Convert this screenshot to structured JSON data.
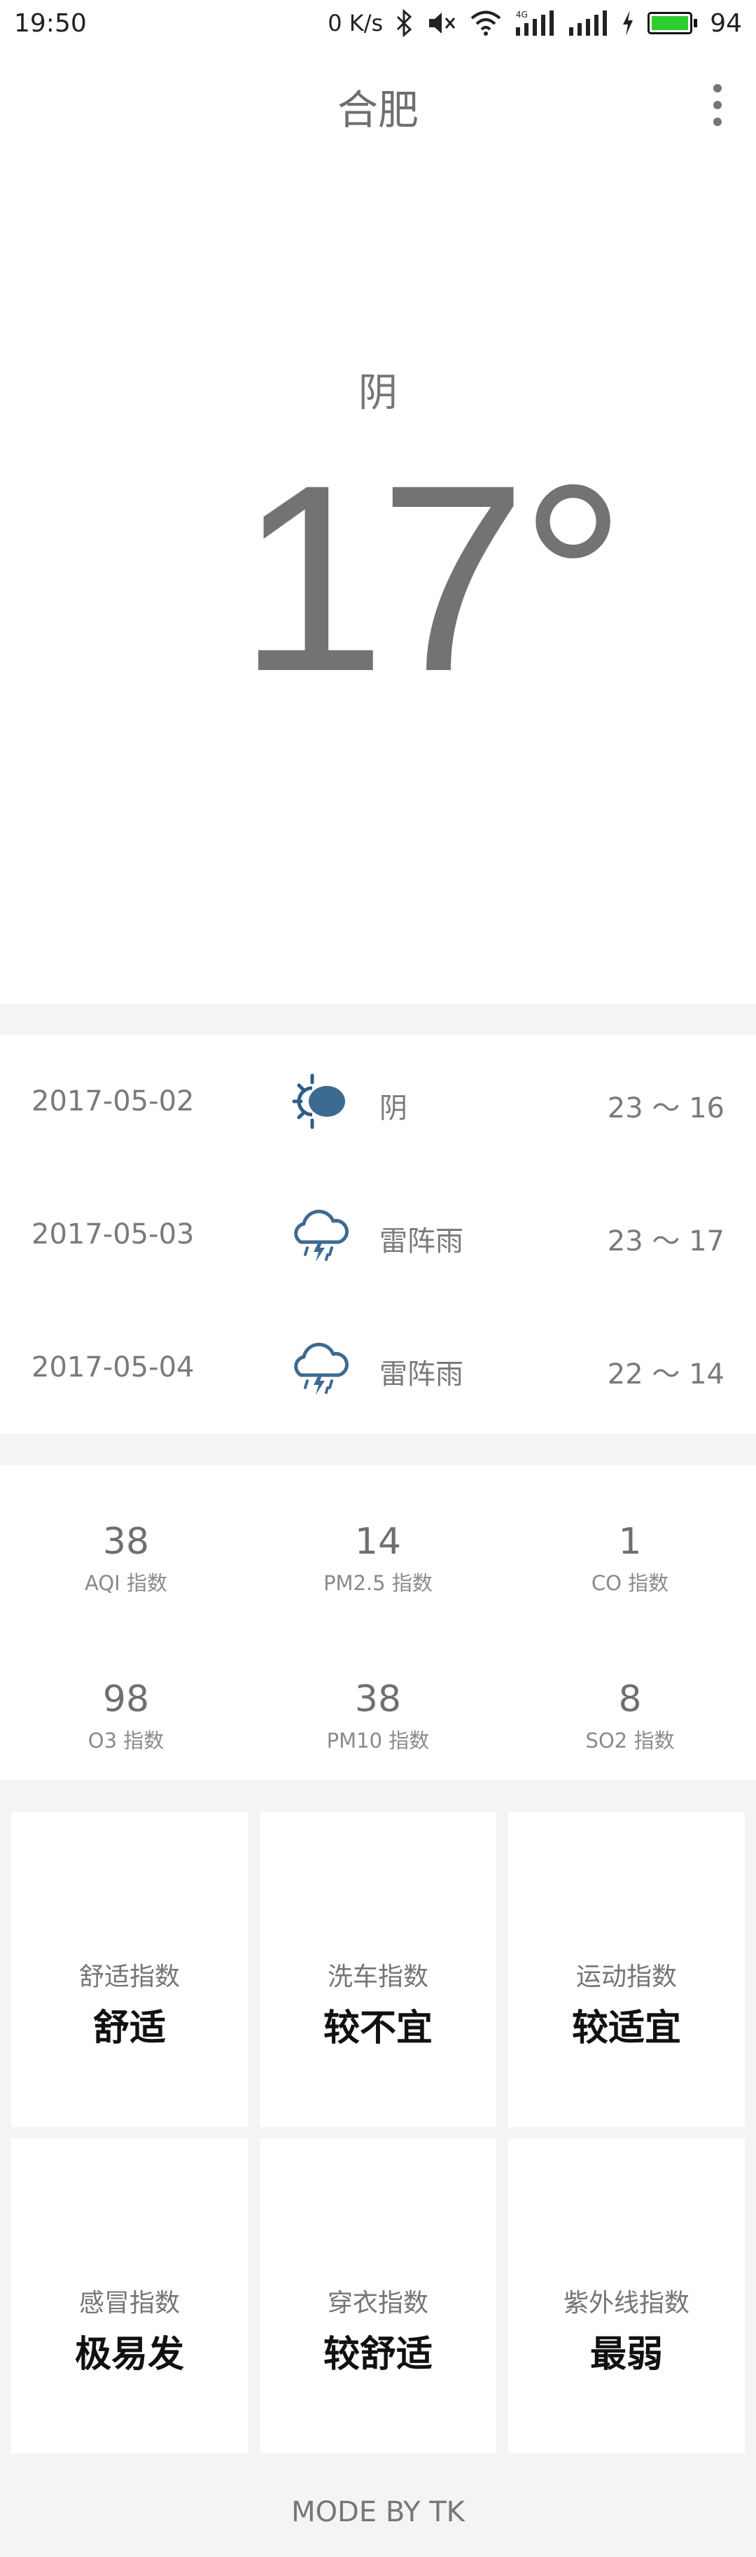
{
  "status_bar": {
    "time": "19:50",
    "net_speed": "0 K/s",
    "battery": "94",
    "icons": [
      "bluetooth-icon",
      "mute-icon",
      "wifi-icon",
      "signal-4g-icon",
      "signal-icon",
      "charging-icon",
      "battery-icon"
    ]
  },
  "header": {
    "city": "合肥",
    "menu_icon": "more-vertical-icon"
  },
  "current": {
    "condition": "阴",
    "temperature": "17°"
  },
  "forecast": [
    {
      "date": "2017-05-02",
      "icon": "cloudy-sun-icon",
      "condition": "阴",
      "range": "23 ～ 16"
    },
    {
      "date": "2017-05-03",
      "icon": "thunderstorm-icon",
      "condition": "雷阵雨",
      "range": "23 ～ 17"
    },
    {
      "date": "2017-05-04",
      "icon": "thunderstorm-icon",
      "condition": "雷阵雨",
      "range": "22 ～ 14"
    }
  ],
  "air": [
    {
      "value": "38",
      "label": "AQI 指数"
    },
    {
      "value": "14",
      "label": "PM2.5 指数"
    },
    {
      "value": "1",
      "label": "CO 指数"
    },
    {
      "value": "98",
      "label": "O3 指数"
    },
    {
      "value": "38",
      "label": "PM10 指数"
    },
    {
      "value": "8",
      "label": "SO2 指数"
    }
  ],
  "life": [
    {
      "label": "舒适指数",
      "value": "舒适"
    },
    {
      "label": "洗车指数",
      "value": "较不宜"
    },
    {
      "label": "运动指数",
      "value": "较适宜"
    },
    {
      "label": "感冒指数",
      "value": "极易发"
    },
    {
      "label": "穿衣指数",
      "value": "较舒适"
    },
    {
      "label": "紫外线指数",
      "value": "最弱"
    }
  ],
  "footer": "MODE BY TK",
  "colors": {
    "icon_blue": "#3d6a91",
    "sun_blue": "#2f5d87",
    "battery_green": "#2ecc2e"
  }
}
